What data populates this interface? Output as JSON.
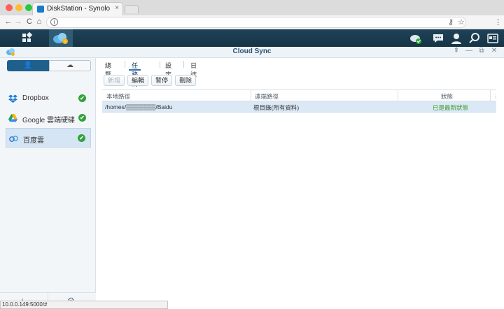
{
  "browser": {
    "tab_title": "DiskStation - Synology DiskSt...",
    "tab_close": "×",
    "nav": {
      "back": "←",
      "forward": "→",
      "reload": "C",
      "home": "⌂"
    },
    "address_info": "i",
    "right_icons": {
      "key": "⚷",
      "star": "☆",
      "menu": "⋮"
    }
  },
  "taskbar": {
    "home_icon": "app-grid-icon",
    "active_app_icon": "cloud-sync-icon",
    "right_icons": [
      "cloud-status-icon",
      "chat-icon",
      "user-icon",
      "search-icon",
      "widget-icon"
    ]
  },
  "window": {
    "title": "Cloud Sync",
    "controls": {
      "pin": "⇞",
      "minimize": "—",
      "restore": "⧉",
      "close": "✕"
    }
  },
  "sidebar": {
    "segments": {
      "user": "👤",
      "cloud": "☁"
    },
    "connections": [
      {
        "label": "Dropbox",
        "status": "✔",
        "icon": "dropbox-icon"
      },
      {
        "label": "Google 雲端硬碟",
        "status": "✔",
        "icon": "google-drive-icon"
      },
      {
        "label": "百度雲",
        "status": "✔",
        "icon": "baidu-cloud-icon"
      }
    ],
    "bottom": {
      "add": "+",
      "settings": "⚙"
    }
  },
  "main": {
    "tabs": [
      "總覽",
      "任務清單",
      "設定",
      "日誌"
    ],
    "active_tab": "任務清單",
    "toolbar": {
      "new": "新增",
      "edit": "編輯",
      "pause": "暫停",
      "delete": "刪除"
    },
    "table": {
      "columns": [
        "本地路徑",
        "遠端路徑",
        "狀態"
      ],
      "rows": [
        {
          "local": "/homes/▒▒▒▒▒▒▒/Baidu",
          "remote": "根目錄(所有資料)",
          "status": "已是最新狀態"
        }
      ]
    }
  },
  "status_bar": {
    "url": "10.0.0.149:5000/#"
  },
  "colors": {
    "accent": "#1f5f8c",
    "ok": "#2fa33a",
    "taskbar": "#1f4257",
    "selected_row": "#dbe8f5"
  }
}
